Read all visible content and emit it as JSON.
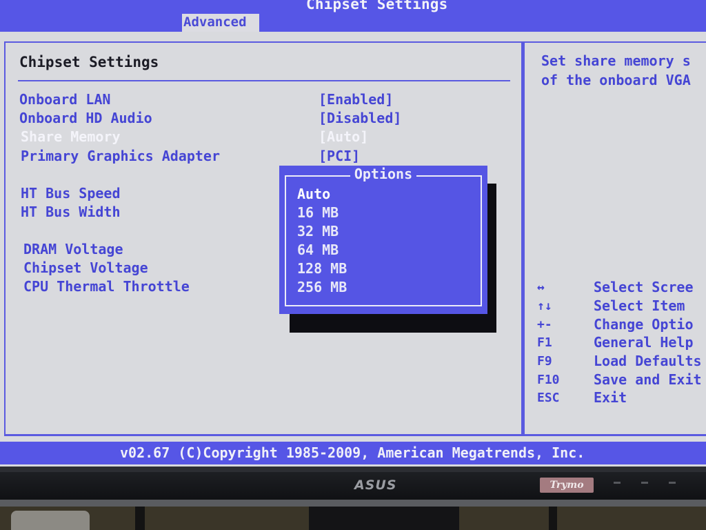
{
  "window_title": "Chipset Settings",
  "active_tab": "Advanced",
  "section_title": "Chipset Settings",
  "settings": [
    {
      "label": "Onboard LAN",
      "value": "[Enabled]"
    },
    {
      "label": "Onboard HD Audio",
      "value": "[Disabled]"
    },
    {
      "label": "Share Memory",
      "value": "[Auto]",
      "selected": true
    },
    {
      "label": "Primary Graphics Adapter",
      "value": "[PCI]"
    },
    {
      "label": "HT Bus Speed",
      "value": ""
    },
    {
      "label": "HT Bus Width",
      "value": ""
    },
    {
      "label": "DRAM Voltage",
      "value": ""
    },
    {
      "label": "Chipset Voltage",
      "value": ""
    },
    {
      "label": "CPU Thermal Throttle",
      "value": ""
    }
  ],
  "help": {
    "line1": "Set share memory s",
    "line2": "of the onboard VGA"
  },
  "options_popup": {
    "title": "Options",
    "options": [
      "Auto",
      "16 MB",
      "32 MB",
      "64 MB",
      "128 MB",
      "256 MB"
    ],
    "selected_index": 0
  },
  "key_legend": [
    {
      "key": "↔",
      "desc": "Select Scree"
    },
    {
      "key": "↑↓",
      "desc": "Select Item"
    },
    {
      "key": "+-",
      "desc": "Change Optio"
    },
    {
      "key": "F1",
      "desc": "General Help"
    },
    {
      "key": "F9",
      "desc": "Load Defaults"
    },
    {
      "key": "F10",
      "desc": "Save and Exit"
    },
    {
      "key": "ESC",
      "desc": "Exit"
    }
  ],
  "footer": "v02.67 (C)Copyright 1985-2009, American Megatrends, Inc.",
  "monitor": {
    "brand": "ASUS",
    "badge": "Trymo"
  },
  "colors": {
    "accent_blue": "#5656e6",
    "text_blue": "#4545d4",
    "background": "#d9dade"
  }
}
